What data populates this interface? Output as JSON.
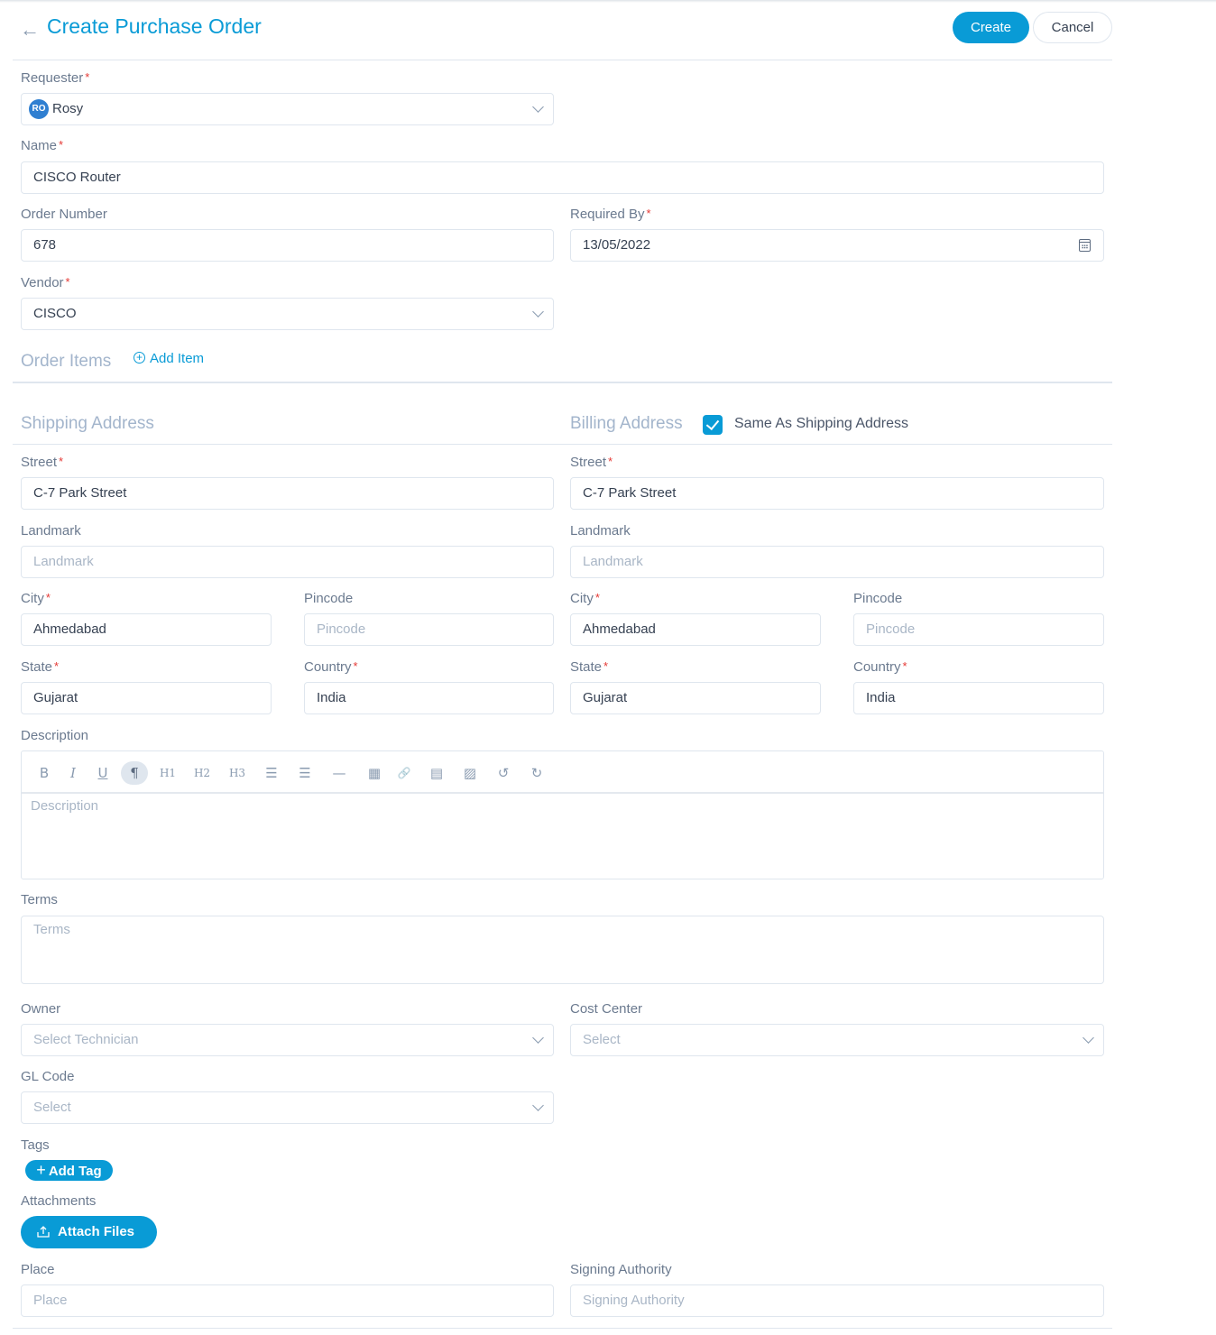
{
  "header": {
    "back_icon": "arrow-left-icon",
    "title": "Create Purchase Order",
    "create_label": "Create",
    "cancel_label": "Cancel"
  },
  "form": {
    "requester": {
      "label": "Requester",
      "required": true,
      "avatar_initials": "RO",
      "value": "Rosy"
    },
    "name": {
      "label": "Name",
      "required": true,
      "value": "CISCO Router"
    },
    "order_number": {
      "label": "Order Number",
      "value": "678"
    },
    "required_by": {
      "label": "Required By",
      "required": true,
      "value": "13/05/2022"
    },
    "vendor": {
      "label": "Vendor",
      "required": true,
      "value": "CISCO"
    }
  },
  "order_items": {
    "title": "Order Items",
    "add_label": "Add Item"
  },
  "shipping": {
    "title": "Shipping Address",
    "street": {
      "label": "Street",
      "value": "C-7 Park Street"
    },
    "landmark": {
      "label": "Landmark",
      "placeholder": "Landmark"
    },
    "city": {
      "label": "City",
      "value": "Ahmedabad"
    },
    "pincode": {
      "label": "Pincode",
      "placeholder": "Pincode"
    },
    "state": {
      "label": "State",
      "value": "Gujarat"
    },
    "country": {
      "label": "Country",
      "value": "India"
    }
  },
  "billing": {
    "title": "Billing Address",
    "same_as_shipping_label": "Same As Shipping Address",
    "same_as_shipping_checked": true,
    "street": {
      "label": "Street",
      "value": "C-7 Park Street"
    },
    "landmark": {
      "label": "Landmark",
      "placeholder": "Landmark"
    },
    "city": {
      "label": "City",
      "value": "Ahmedabad"
    },
    "pincode": {
      "label": "Pincode",
      "placeholder": "Pincode"
    },
    "state": {
      "label": "State",
      "value": "Gujarat"
    },
    "country": {
      "label": "Country",
      "value": "India"
    }
  },
  "description": {
    "label": "Description",
    "placeholder": "Description",
    "toolbar": {
      "bold": "B",
      "italic": "I",
      "underline": "U",
      "paragraph": "¶",
      "h1": "H1",
      "h2": "H2",
      "h3": "H3",
      "bullet_list": "☰",
      "ordered_list": "☰",
      "hr": "—",
      "table": "▦",
      "link": "🔗",
      "video": "▤",
      "image": "▨",
      "undo": "↺",
      "redo": "↻"
    }
  },
  "terms": {
    "label": "Terms",
    "placeholder": "Terms"
  },
  "owner": {
    "label": "Owner",
    "placeholder": "Select Technician"
  },
  "cost_center": {
    "label": "Cost Center",
    "placeholder": "Select"
  },
  "gl_code": {
    "label": "GL Code",
    "placeholder": "Select"
  },
  "tags": {
    "label": "Tags",
    "add_label": "Add Tag"
  },
  "attachments": {
    "label": "Attachments",
    "button_label": "Attach Files"
  },
  "place": {
    "label": "Place",
    "placeholder": "Place"
  },
  "signing_authority": {
    "label": "Signing Authority",
    "placeholder": "Signing Authority"
  },
  "colors": {
    "accent": "#099bd6",
    "required": "#e53935",
    "section": "#a3b5cc",
    "border": "#dfe6ee"
  }
}
